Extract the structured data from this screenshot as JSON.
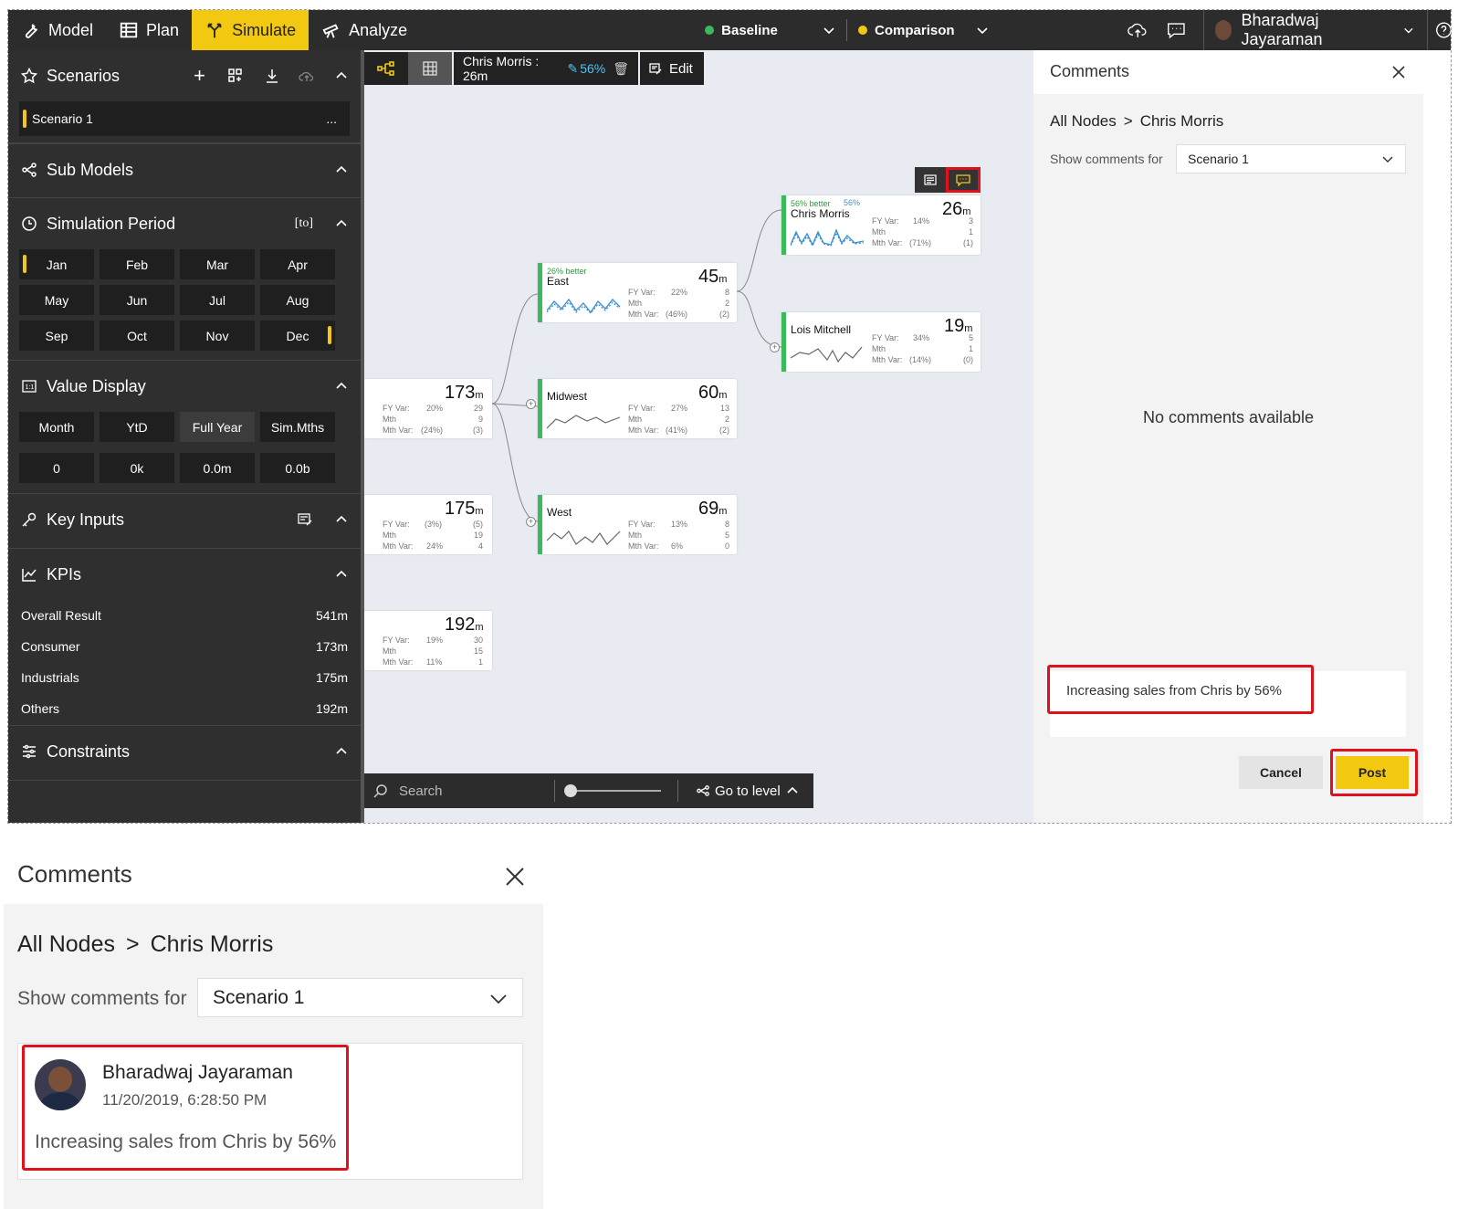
{
  "topbar": {
    "tabs": [
      {
        "label": "Model",
        "icon": "wrench-icon"
      },
      {
        "label": "Plan",
        "icon": "table-icon"
      },
      {
        "label": "Simulate",
        "icon": "fork-icon",
        "active": true
      },
      {
        "label": "Analyze",
        "icon": "telescope-icon"
      }
    ],
    "baseline_label": "Baseline",
    "comparison_label": "Comparison",
    "user_name": "Bharadwaj Jayaraman",
    "colors": {
      "bar": "#2c2c2c",
      "accent": "#f2c811",
      "baseline": "#3cb95a",
      "comparison": "#f2c811"
    }
  },
  "left": {
    "scenarios": {
      "title": "Scenarios",
      "item": "Scenario 1",
      "more": "..."
    },
    "submodels": {
      "title": "Sub Models"
    },
    "simperiod": {
      "title": "Simulation Period",
      "tag": "[to]",
      "months": [
        "Jan",
        "Feb",
        "Mar",
        "Apr",
        "May",
        "Jun",
        "Jul",
        "Aug",
        "Sep",
        "Oct",
        "Nov",
        "Dec"
      ]
    },
    "valuedisplay": {
      "title": "Value Display",
      "modes": [
        "Month",
        "YtD",
        "Full Year",
        "Sim.Mths"
      ],
      "selected_mode": "Full Year",
      "formats": [
        "0",
        "0k",
        "0.0m",
        "0.0b"
      ]
    },
    "keyinputs": {
      "title": "Key Inputs"
    },
    "kpis": {
      "title": "KPIs",
      "rows": [
        {
          "label": "Overall Result",
          "value": "541m"
        },
        {
          "label": "Consumer",
          "value": "173m"
        },
        {
          "label": "Industrials",
          "value": "175m"
        },
        {
          "label": "Others",
          "value": "192m"
        }
      ]
    },
    "constraints": {
      "title": "Constraints"
    }
  },
  "canvas": {
    "toolbar": {
      "node_label": "Chris Morris : 26m",
      "pct": "56%",
      "edit": "Edit"
    },
    "search_placeholder": "Search",
    "goto_level": "Go to level",
    "fy_var": "FY Var:",
    "mth": "Mth",
    "mth_var": "Mth Var:",
    "nodes": {
      "chris": {
        "name": "Chris Morris",
        "better": "56% better",
        "pct": "56%",
        "value": "26",
        "unit": "m",
        "fy": "14%",
        "fy2": "3",
        "mth2": "1",
        "mthvar": "(71%)",
        "mthvar2": "(1)"
      },
      "lois": {
        "name": "Lois Mitchell",
        "value": "19",
        "unit": "m",
        "fy": "34%",
        "fy2": "5",
        "mth2": "1",
        "mthvar": "(14%)",
        "mthvar2": "(0)"
      },
      "east": {
        "name": "East",
        "better": "26% better",
        "value": "45",
        "unit": "m",
        "fy": "22%",
        "fy2": "8",
        "mth2": "2",
        "mthvar": "(46%)",
        "mthvar2": "(2)"
      },
      "midwest": {
        "name": "Midwest",
        "value": "60",
        "unit": "m",
        "fy": "27%",
        "fy2": "13",
        "mth2": "2",
        "mthvar": "(41%)",
        "mthvar2": "(2)"
      },
      "west": {
        "name": "West",
        "value": "69",
        "unit": "m",
        "fy": "13%",
        "fy2": "8",
        "mth2": "5",
        "mthvar": "6%",
        "mthvar2": "0"
      },
      "c173": {
        "value": "173",
        "unit": "m",
        "fy": "20%",
        "fy2": "29",
        "mth2": "9",
        "mthvar": "(24%)",
        "mthvar2": "(3)"
      },
      "c175": {
        "value": "175",
        "unit": "m",
        "fy": "(3%)",
        "fy2": "(5)",
        "mth2": "19",
        "mthvar": "24%",
        "mthvar2": "4"
      },
      "c192": {
        "value": "192",
        "unit": "m",
        "fy": "19%",
        "fy2": "30",
        "mth2": "15",
        "mthvar": "11%",
        "mthvar2": "1"
      }
    }
  },
  "comments": {
    "title": "Comments",
    "crumb_root": "All Nodes",
    "crumb_sep": ">",
    "crumb_node": "Chris Morris",
    "show_for_label": "Show comments for",
    "scenario": "Scenario 1",
    "empty": "No comments available",
    "draft": "Increasing sales from Chris by 56%",
    "cancel": "Cancel",
    "post": "Post"
  },
  "posted": {
    "title": "Comments",
    "crumb_root": "All Nodes",
    "crumb_sep": ">",
    "crumb_node": "Chris Morris",
    "show_for_label": "Show comments for",
    "scenario": "Scenario 1",
    "author": "Bharadwaj Jayaraman",
    "timestamp": "11/20/2019, 6:28:50 PM",
    "text": "Increasing sales from Chris by 56%"
  }
}
